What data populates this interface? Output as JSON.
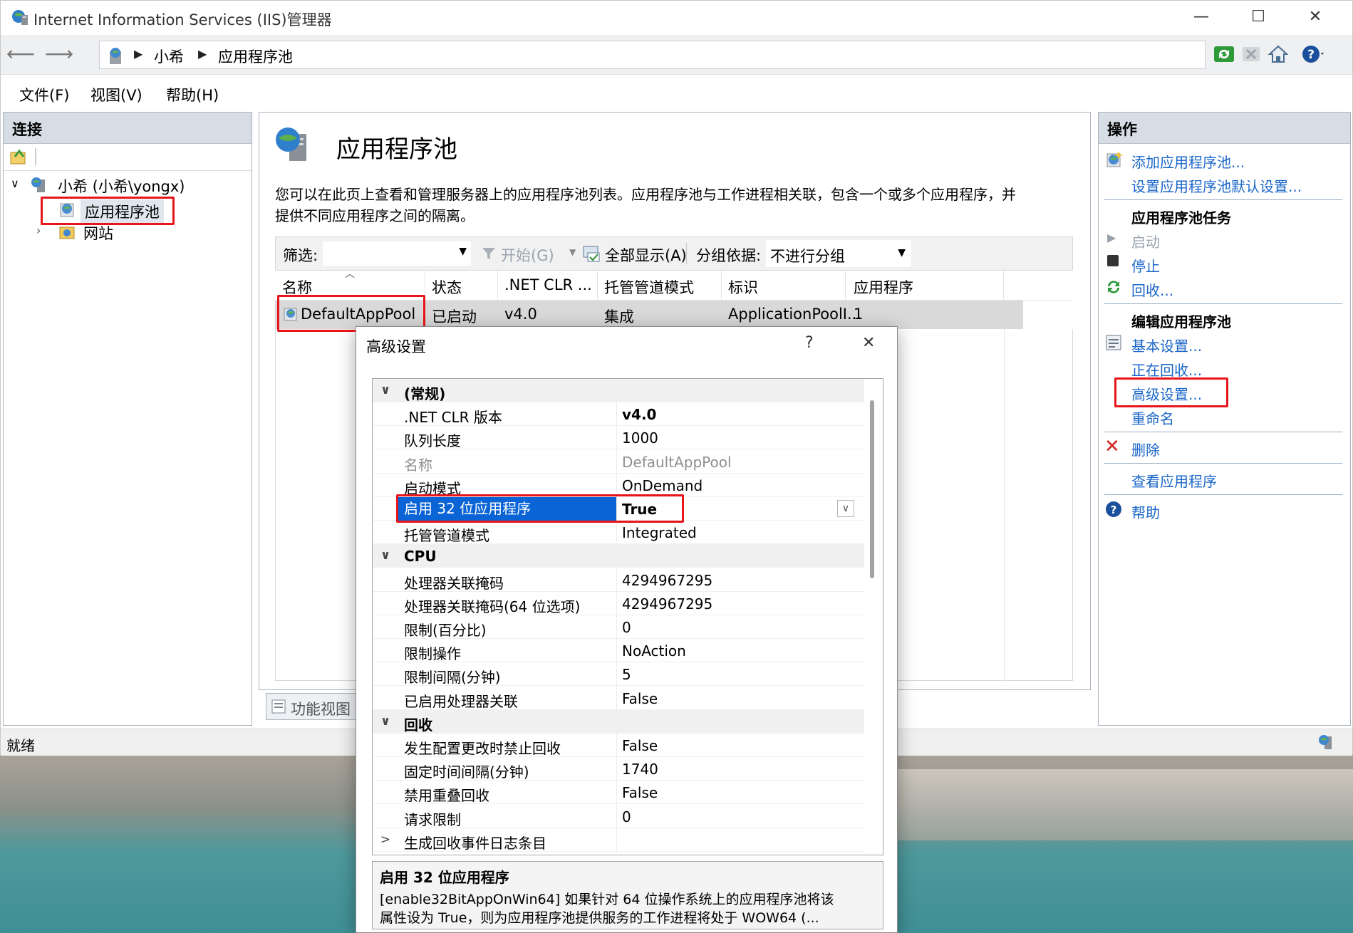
{
  "window": {
    "title": "Internet Information Services (IIS)管理器",
    "controls": {
      "minimize": "—",
      "maximize": "☐",
      "close": "✕"
    }
  },
  "address": {
    "crumbs": [
      "小希",
      "应用程序池"
    ]
  },
  "menu": [
    "文件(F)",
    "视图(V)",
    "帮助(H)"
  ],
  "connections": {
    "header": "连接",
    "server": "小希 (小希\\yongx)",
    "app_pools": "应用程序池",
    "sites": "网站"
  },
  "center": {
    "title": "应用程序池",
    "description_line1": "您可以在此页上查看和管理服务器上的应用程序池列表。应用程序池与工作进程相关联，包含一个或多个应用程序，并",
    "description_line2": "提供不同应用程序之间的隔离。",
    "filter_label": "筛选:",
    "start_label": "开始(G)",
    "show_all_label": "全部显示(A)",
    "group_by_label": "分组依据:",
    "group_by_value": "不进行分组",
    "columns": [
      "名称",
      "状态",
      ".NET CLR ...",
      "托管管道模式",
      "标识",
      "应用程序"
    ],
    "row": [
      "DefaultAppPool",
      "已启动",
      "v4.0",
      "集成",
      "ApplicationPoolI...",
      "1"
    ],
    "features_view_tab": "功能视图"
  },
  "actions": {
    "header": "操作",
    "add_pool": "添加应用程序池...",
    "set_defaults": "设置应用程序池默认设置...",
    "tasks_title": "应用程序池任务",
    "start": "启动",
    "stop": "停止",
    "recycle": "回收...",
    "edit_title": "编辑应用程序池",
    "basic_settings": "基本设置...",
    "recycling": "正在回收...",
    "advanced_settings": "高级设置...",
    "rename": "重命名",
    "delete": "删除",
    "view_apps": "查看应用程序",
    "help": "帮助"
  },
  "status": {
    "text": "就绪"
  },
  "dialog": {
    "title": "高级设置",
    "help": "?",
    "close": "✕",
    "rows": [
      {
        "type": "cat",
        "name": "(常规)",
        "toggle": "∨"
      },
      {
        "type": "prop",
        "name": ".NET CLR 版本",
        "value": "v4.0",
        "bold": true
      },
      {
        "type": "prop",
        "name": "队列长度",
        "value": "1000"
      },
      {
        "type": "prop",
        "name": "名称",
        "value": "DefaultAppPool",
        "disabled": true
      },
      {
        "type": "prop",
        "name": "启动模式",
        "value": "OnDemand"
      },
      {
        "type": "prop",
        "name": "启用 32 位应用程序",
        "value": "True",
        "bold": true,
        "selected": true
      },
      {
        "type": "prop",
        "name": "托管管道模式",
        "value": "Integrated"
      },
      {
        "type": "cat",
        "name": "CPU",
        "toggle": "∨"
      },
      {
        "type": "prop",
        "name": "处理器关联掩码",
        "value": "4294967295"
      },
      {
        "type": "prop",
        "name": "处理器关联掩码(64 位选项)",
        "value": "4294967295"
      },
      {
        "type": "prop",
        "name": "限制(百分比)",
        "value": "0"
      },
      {
        "type": "prop",
        "name": "限制操作",
        "value": "NoAction"
      },
      {
        "type": "prop",
        "name": "限制间隔(分钟)",
        "value": "5"
      },
      {
        "type": "prop",
        "name": "已启用处理器关联",
        "value": "False"
      },
      {
        "type": "cat",
        "name": "回收",
        "toggle": "∨"
      },
      {
        "type": "prop",
        "name": "发生配置更改时禁止回收",
        "value": "False"
      },
      {
        "type": "prop",
        "name": "固定时间间隔(分钟)",
        "value": "1740"
      },
      {
        "type": "prop",
        "name": "禁用重叠回收",
        "value": "False"
      },
      {
        "type": "prop",
        "name": "请求限制",
        "value": "0"
      },
      {
        "type": "prop",
        "name": "生成回收事件日志条目",
        "value": "",
        "toggle": ">"
      }
    ],
    "desc_title": "启用 32 位应用程序",
    "desc_line1": "[enable32BitAppOnWin64] 如果针对 64 位操作系统上的应用程序池将该",
    "desc_line2": "属性设为 True，则为应用程序池提供服务的工作进程将处于 WOW64 (..."
  },
  "colors": {
    "highlight_red": "#e8151a",
    "selection_blue": "#0a64d6",
    "link_blue": "#1a66c8"
  }
}
